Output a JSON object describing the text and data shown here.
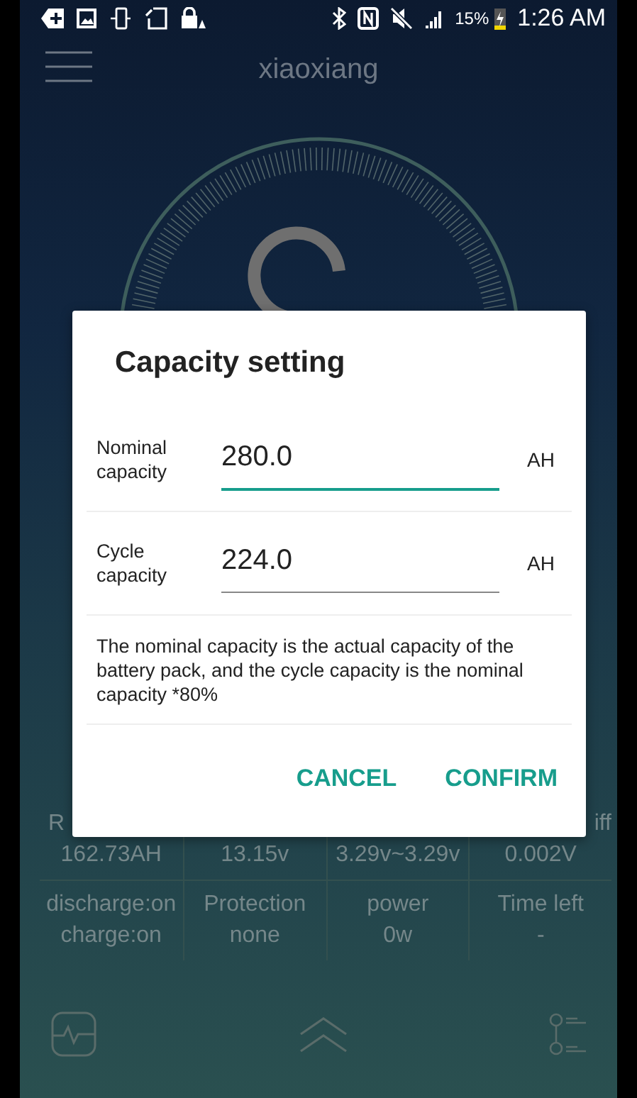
{
  "status_bar": {
    "battery_text": "15%",
    "time": "1:26 AM"
  },
  "header": {
    "title": "xiaoxiang"
  },
  "stats": [
    [
      {
        "label": "R",
        "value": "162.73AH"
      },
      {
        "value": "13.15v"
      },
      {
        "value": "3.29v~3.29v"
      },
      {
        "label": "iff",
        "value": "0.002V"
      }
    ],
    [
      {
        "label": "discharge:on",
        "value": "charge:on"
      },
      {
        "label": "Protection",
        "value": "none"
      },
      {
        "label": "power",
        "value": "0w"
      },
      {
        "label": "Time left",
        "value": "-"
      }
    ]
  ],
  "dialog": {
    "title": "Capacity setting",
    "fields": [
      {
        "label": "Nominal capacity",
        "value": "280.0",
        "unit": "AH",
        "focused": true
      },
      {
        "label": "Cycle capacity",
        "value": "224.0",
        "unit": "AH",
        "focused": false
      }
    ],
    "note": "The nominal capacity is the actual capacity of the battery pack, and the cycle capacity is the nominal capacity *80%",
    "buttons": [
      "CANCEL",
      "CONFIRM"
    ]
  }
}
